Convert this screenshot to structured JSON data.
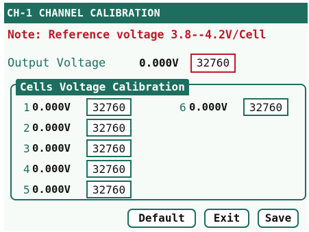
{
  "title": "CH-1 CHANNEL CALIBRATION",
  "note": "Note: Reference voltage 3.8--4.2V/Cell",
  "output": {
    "label": "Output Voltage",
    "voltage": "0.000V",
    "value": "32760"
  },
  "cells": {
    "title": "Cells Voltage Calibration",
    "items": [
      {
        "index": "1",
        "voltage": "0.000V",
        "value": "32760"
      },
      {
        "index": "2",
        "voltage": "0.000V",
        "value": "32760"
      },
      {
        "index": "3",
        "voltage": "0.000V",
        "value": "32760"
      },
      {
        "index": "4",
        "voltage": "0.000V",
        "value": "32760"
      },
      {
        "index": "5",
        "voltage": "0.000V",
        "value": "32760"
      },
      {
        "index": "6",
        "voltage": "0.000V",
        "value": "32760"
      }
    ]
  },
  "buttons": {
    "default": "Default",
    "exit": "Exit",
    "save": "Save"
  },
  "colors": {
    "accent": "#1d6e5e",
    "note": "#c0182a",
    "background": "#f6fbf8"
  }
}
